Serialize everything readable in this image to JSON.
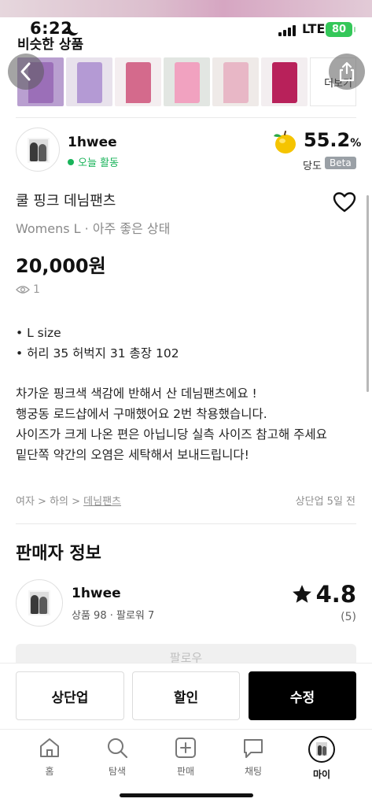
{
  "status_bar": {
    "time": "6:22",
    "network": "LTE",
    "battery": "80"
  },
  "similar": {
    "title": "비슷한 상품",
    "more_label": "더보기",
    "thumb_icons": [
      "purple-pants-photo",
      "lavender-pants-photo",
      "pink-pants-photo",
      "light-pink-pants-photo",
      "blush-pants-photo",
      "magenta-pants-photo"
    ]
  },
  "seller": {
    "name": "1hwee",
    "activity": "오늘 활동",
    "sweetness_value": "55.2",
    "sweetness_unit": "%",
    "sweetness_label": "당도",
    "beta": "Beta"
  },
  "product": {
    "title": "쿨 핑크 데님팬츠",
    "subtitle": "Womens L · 아주 좋은 상태",
    "price": "20,000원",
    "views": "1",
    "desc_lines_a": [
      "• L size",
      "• 허리 35 허벅지 31 총장 102"
    ],
    "desc_lines_b": [
      "차가운 핑크색 색감에 반해서 산 데님팬츠에요 !",
      "행궁동 로드샵에서 구매했어요 2번 착용했습니다.",
      "사이즈가 크게 나온 편은 아닙니당 실측 사이즈 참고해 주세요",
      "밑단쪽 약간의 오염은 세탁해서 보내드립니다!"
    ],
    "breadcrumb": {
      "prefix": "여자 > 하의 > ",
      "current": "데님팬츠"
    },
    "bumped": "상단업 5일 전"
  },
  "seller_info": {
    "title": "판매자 정보",
    "name": "1hwee",
    "stats": "상품 98 · 팔로워 7",
    "rating": "4.8",
    "rating_count": "(5)",
    "follow_label": "팔로우"
  },
  "actions": {
    "bump": "상단업",
    "discount": "할인",
    "edit": "수정"
  },
  "tabs": [
    {
      "label": "홈",
      "icon": "home-icon"
    },
    {
      "label": "탐색",
      "icon": "search-icon"
    },
    {
      "label": "판매",
      "icon": "plus-box-icon"
    },
    {
      "label": "채팅",
      "icon": "chat-icon"
    },
    {
      "label": "마이",
      "icon": "profile-avatar-icon"
    }
  ],
  "colors": {
    "accent_green": "#19b35a",
    "primary": "#000000",
    "battery": "#34c759"
  }
}
